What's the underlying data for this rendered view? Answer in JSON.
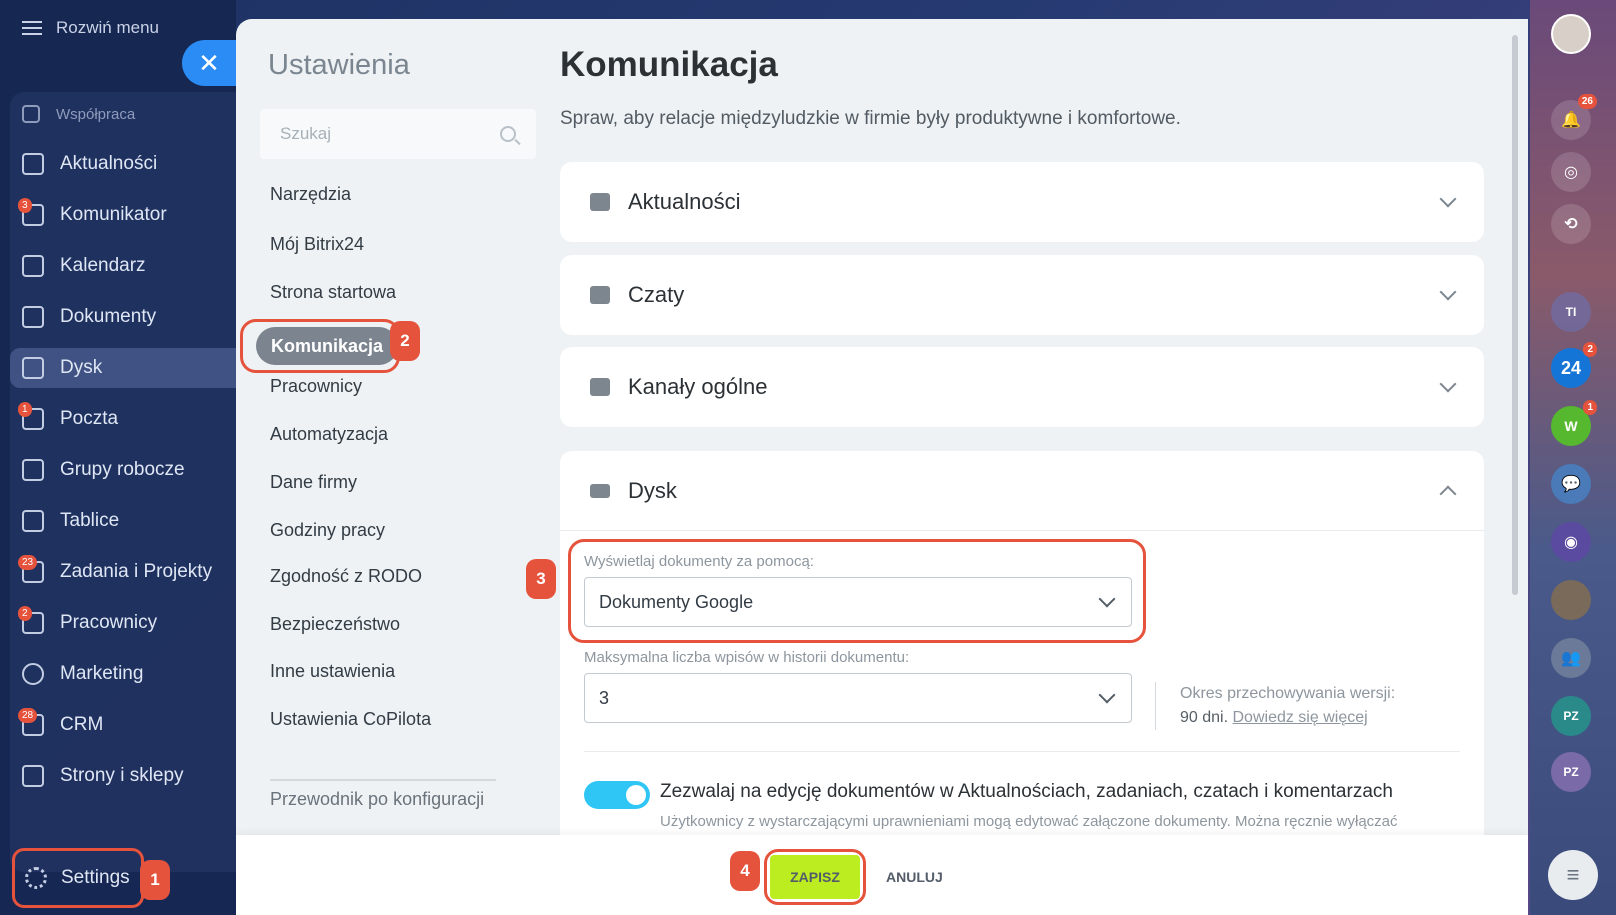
{
  "sidebar": {
    "expand_label": "Rozwiń menu",
    "items": [
      {
        "label": "Współpraca",
        "badge": ""
      },
      {
        "label": "Aktualności",
        "badge": ""
      },
      {
        "label": "Komunikator",
        "badge": "3"
      },
      {
        "label": "Kalendarz",
        "badge": ""
      },
      {
        "label": "Dokumenty",
        "badge": ""
      },
      {
        "label": "Dysk",
        "badge": ""
      },
      {
        "label": "Poczta",
        "badge": "1"
      },
      {
        "label": "Grupy robocze",
        "badge": ""
      },
      {
        "label": "Tablice",
        "badge": ""
      },
      {
        "label": "Zadania i Projekty",
        "badge": "23"
      },
      {
        "label": "Pracownicy",
        "badge": "2"
      },
      {
        "label": "Marketing",
        "badge": ""
      },
      {
        "label": "CRM",
        "badge": "28"
      },
      {
        "label": "Strony i sklepy",
        "badge": ""
      }
    ],
    "settings_label": "Settings"
  },
  "steps": [
    "1",
    "2",
    "3",
    "4"
  ],
  "settings_panel": {
    "title": "Ustawienia",
    "search_placeholder": "Szukaj",
    "menu": [
      "Narzędzia",
      "Mój Bitrix24",
      "Strona startowa",
      "Komunikacja",
      "Pracownicy",
      "Automatyzacja",
      "Dane firmy",
      "Godziny pracy",
      "Zgodność z RODO",
      "Bezpieczeństwo",
      "Inne ustawienia",
      "Ustawienia CoPilota",
      "Przewodnik po konfiguracji"
    ]
  },
  "content": {
    "title": "Komunikacja",
    "description": "Spraw, aby relacje międzyludzkie w firmie były produktywne i komfortowe.",
    "sections": [
      "Aktualności",
      "Czaty",
      "Kanały ogólne",
      "Dysk"
    ],
    "disk": {
      "display_label": "Wyświetlaj dokumenty za pomocą:",
      "display_value": "Dokumenty Google",
      "history_label": "Maksymalna liczba wpisów w historii dokumentu:",
      "history_value": "3",
      "retention_label": "Okres przechowywania wersji:",
      "retention_value": "90 dni.",
      "learn_more": "Dowiedz się więcej",
      "toggle_label": "Zezwalaj na edycję dokumentów w Aktualnościach, zadaniach, czatach i komentarzach",
      "toggle_desc": "Użytkownicy z wystarczającymi uprawnieniami mogą edytować załączone dokumenty. Można ręcznie wyłączać",
      "toggle_on": true
    }
  },
  "footer": {
    "save_label": "ZAPISZ",
    "cancel_label": "ANULUJ"
  },
  "rightbar": {
    "notif_badge": "26",
    "ti_label": "TI",
    "b24_label": "24",
    "b24_badge": "2",
    "w_label": "W",
    "w_badge": "1",
    "pz1_label": "PZ",
    "pz2_label": "PZ"
  },
  "colors": {
    "accent": "#2b8cf5",
    "highlight": "#e5533d",
    "save": "#bbed21",
    "toggle": "#2fc6f6"
  }
}
